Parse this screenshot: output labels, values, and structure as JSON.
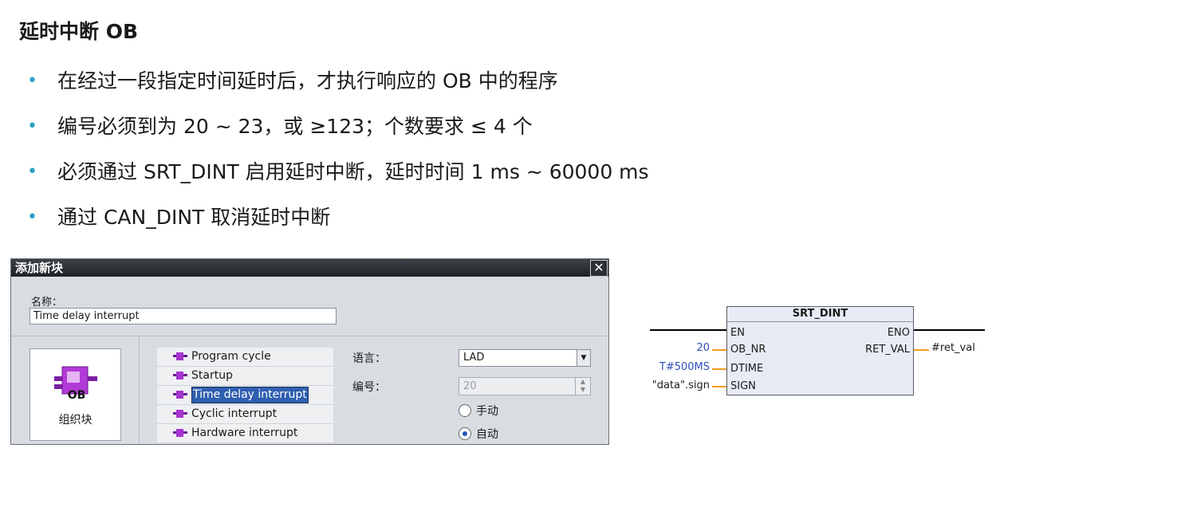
{
  "title": "延时中断 OB",
  "bullets": [
    "在经过一段指定时间延时后，才执行响应的 OB 中的程序",
    "编号必须到为 20 ~ 23，或 ≥123；个数要求 ≤ 4 个",
    "必须通过 SRT_DINT 启用延时中断，延时时间 1 ms ~ 60000 ms",
    "通过 CAN_DINT 取消延时中断"
  ],
  "dialog": {
    "title": "添加新块",
    "close": "✕",
    "name_label": "名称：",
    "name_value": "Time delay interrupt",
    "block_tile_label": "组织块",
    "block_tile_badge": "OB",
    "ob_types": [
      {
        "label": "Program cycle",
        "selected": false
      },
      {
        "label": "Startup",
        "selected": false
      },
      {
        "label": "Time delay interrupt",
        "selected": true
      },
      {
        "label": "Cyclic interrupt",
        "selected": false
      },
      {
        "label": "Hardware interrupt",
        "selected": false
      }
    ],
    "language_label": "语言：",
    "language_value": "LAD",
    "number_label": "编号：",
    "number_value": "20",
    "radio_manual": "手动",
    "radio_auto": "自动",
    "radio_selected": "自动"
  },
  "block": {
    "name": "SRT_DINT",
    "inputs": [
      "EN",
      "OB_NR",
      "DTIME",
      "SIGN"
    ],
    "outputs": [
      "ENO",
      "RET_VAL"
    ],
    "params": {
      "OB_NR": "20",
      "DTIME": "T#500MS",
      "SIGN": "\"data\".sign",
      "RET_VAL": "#ret_val"
    },
    "colors": {
      "param_blue": "#2d4fb5",
      "wire_orange": "#f39a1e",
      "block_fill": "#e7ebf5"
    }
  }
}
